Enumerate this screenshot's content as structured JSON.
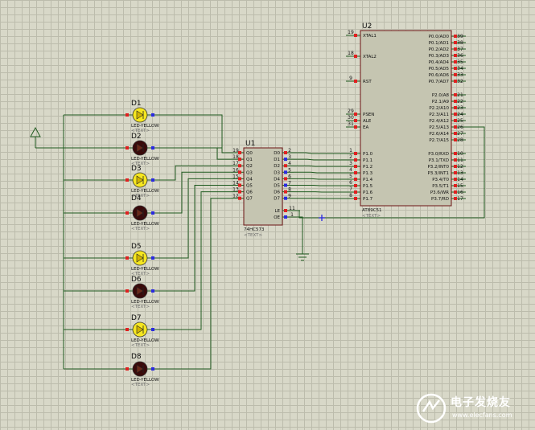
{
  "u1": {
    "ref": "U1",
    "part": "74HC573",
    "text": "<TEXT>",
    "left_pins": [
      {
        "num": "19",
        "name": "Q0"
      },
      {
        "num": "18",
        "name": "Q1"
      },
      {
        "num": "17",
        "name": "Q2"
      },
      {
        "num": "16",
        "name": "Q3"
      },
      {
        "num": "15",
        "name": "Q4"
      },
      {
        "num": "14",
        "name": "Q5"
      },
      {
        "num": "13",
        "name": "Q6"
      },
      {
        "num": "12",
        "name": "Q7"
      }
    ],
    "right_pins": [
      {
        "num": "2",
        "name": "D0"
      },
      {
        "num": "3",
        "name": "D1"
      },
      {
        "num": "4",
        "name": "D2"
      },
      {
        "num": "5",
        "name": "D3"
      },
      {
        "num": "6",
        "name": "D4"
      },
      {
        "num": "7",
        "name": "D5"
      },
      {
        "num": "8",
        "name": "D6"
      },
      {
        "num": "9",
        "name": "D7"
      }
    ],
    "ctrl_pins": [
      {
        "num": "11",
        "name": "LE"
      },
      {
        "num": "1",
        "name": "OE"
      }
    ]
  },
  "u2": {
    "ref": "U2",
    "part": "AT89C51",
    "text": "<TEXT>",
    "left_pins": [
      {
        "num": "19",
        "name": "XTAL1"
      },
      {
        "num": "18",
        "name": "XTAL2"
      },
      {
        "num": "9",
        "name": "RST"
      },
      {
        "num": "29",
        "name": "PSEN"
      },
      {
        "num": "30",
        "name": "ALE"
      },
      {
        "num": "31",
        "name": "EA"
      },
      {
        "num": "1",
        "name": "P1.0"
      },
      {
        "num": "2",
        "name": "P1.1"
      },
      {
        "num": "3",
        "name": "P1.2"
      },
      {
        "num": "4",
        "name": "P1.3"
      },
      {
        "num": "5",
        "name": "P1.4"
      },
      {
        "num": "6",
        "name": "P1.5"
      },
      {
        "num": "7",
        "name": "P1.6"
      },
      {
        "num": "8",
        "name": "P1.7"
      }
    ],
    "right_pins": [
      {
        "num": "39",
        "name": "P0.0/AD0"
      },
      {
        "num": "38",
        "name": "P0.1/AD1"
      },
      {
        "num": "37",
        "name": "P0.2/AD2"
      },
      {
        "num": "36",
        "name": "P0.3/AD3"
      },
      {
        "num": "35",
        "name": "P0.4/AD4"
      },
      {
        "num": "34",
        "name": "P0.5/AD5"
      },
      {
        "num": "33",
        "name": "P0.6/AD6"
      },
      {
        "num": "32",
        "name": "P0.7/AD7"
      },
      {
        "num": "21",
        "name": "P2.0/A8"
      },
      {
        "num": "22",
        "name": "P2.1/A9"
      },
      {
        "num": "23",
        "name": "P2.2/A10"
      },
      {
        "num": "24",
        "name": "P2.3/A11"
      },
      {
        "num": "25",
        "name": "P2.4/A12"
      },
      {
        "num": "26",
        "name": "P2.5/A13"
      },
      {
        "num": "27",
        "name": "P2.6/A14"
      },
      {
        "num": "28",
        "name": "P2.7/A15"
      },
      {
        "num": "10",
        "name": "P3.0/RXD"
      },
      {
        "num": "11",
        "name": "P3.1/TXD"
      },
      {
        "num": "12",
        "name": "P3.2/INT0"
      },
      {
        "num": "13",
        "name": "P3.3/INT1"
      },
      {
        "num": "14",
        "name": "P3.4/T0"
      },
      {
        "num": "15",
        "name": "P3.5/T1"
      },
      {
        "num": "16",
        "name": "P3.6/WR"
      },
      {
        "num": "17",
        "name": "P3.7/RD"
      }
    ]
  },
  "leds": [
    {
      "ref": "D1",
      "part": "LED-YELLOW",
      "text": "<TEXT>",
      "lit": true
    },
    {
      "ref": "D2",
      "part": "LED-YELLOW",
      "text": "<TEXT>",
      "lit": false
    },
    {
      "ref": "D3",
      "part": "LED-YELLOW",
      "text": "<TEXT>",
      "lit": true
    },
    {
      "ref": "D4",
      "part": "LED-YELLOW",
      "text": "<TEXT>",
      "lit": false
    },
    {
      "ref": "D5",
      "part": "LED-YELLOW",
      "text": "<TEXT>",
      "lit": true
    },
    {
      "ref": "D6",
      "part": "LED-YELLOW",
      "text": "<TEXT>",
      "lit": false
    },
    {
      "ref": "D7",
      "part": "LED-YELLOW",
      "text": "<TEXT>",
      "lit": true
    },
    {
      "ref": "D8",
      "part": "LED-YELLOW",
      "text": "<TEXT>",
      "lit": false
    }
  ],
  "watermark": {
    "title": "电子发烧友",
    "url": "www.elecfans.com"
  },
  "colors": {
    "wire": "#1f5a1f",
    "component_body": "#c5c5b1",
    "component_outline": "#6b1414",
    "pin_high": "#e02020",
    "pin_low": "#2a2ae0",
    "led_on": "#f5e620",
    "led_off": "#3a0a0a"
  }
}
